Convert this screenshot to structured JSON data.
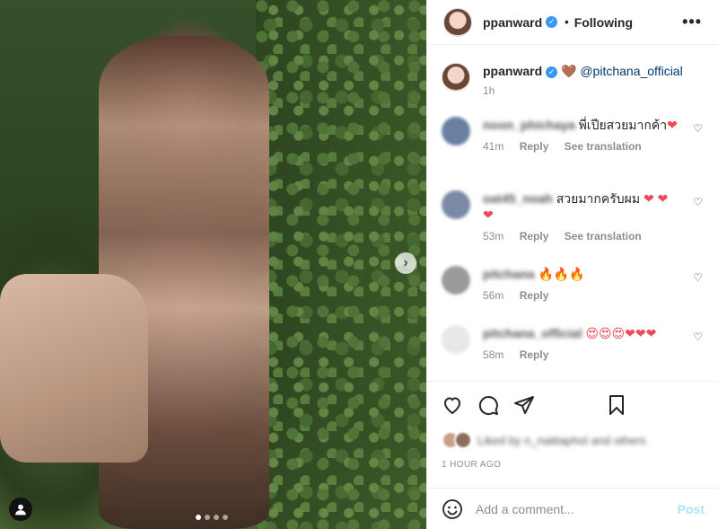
{
  "header": {
    "username": "ppanward",
    "separator": "•",
    "follow_status": "Following",
    "more_label": "•••"
  },
  "caption": {
    "username": "ppanward",
    "emoji": "🤎",
    "mention": "@pitchana_official",
    "time": "1h"
  },
  "comments": [
    {
      "username": "noon_phichaya",
      "text": "พี่เปียสวยมากค้า",
      "emoji": "❤",
      "time": "41m",
      "reply": "Reply",
      "translate": "See translation"
    },
    {
      "username": "oat45_noah",
      "text": "สวยมากครับผม",
      "emoji": "❤ ❤",
      "emoji2": "❤",
      "time": "53m",
      "reply": "Reply",
      "translate": "See translation"
    },
    {
      "username": "pitchana",
      "text": "",
      "emoji": "🔥🔥🔥",
      "time": "56m",
      "reply": "Reply"
    },
    {
      "username": "pitchana_official",
      "text": "",
      "emoji": "😍😍😍❤❤❤",
      "time": "58m",
      "reply": "Reply"
    }
  ],
  "likes": {
    "text": "Liked by n_naittaphol and others"
  },
  "post_time": "1 HOUR AGO",
  "comment_box": {
    "placeholder": "Add a comment...",
    "post_label": "Post"
  },
  "carousel": {
    "next_label": "›",
    "total": 4,
    "active": 1
  },
  "colors": {
    "accent": "#3897f0",
    "heart": "#ed4956",
    "post_disabled": "#b2dffc"
  }
}
